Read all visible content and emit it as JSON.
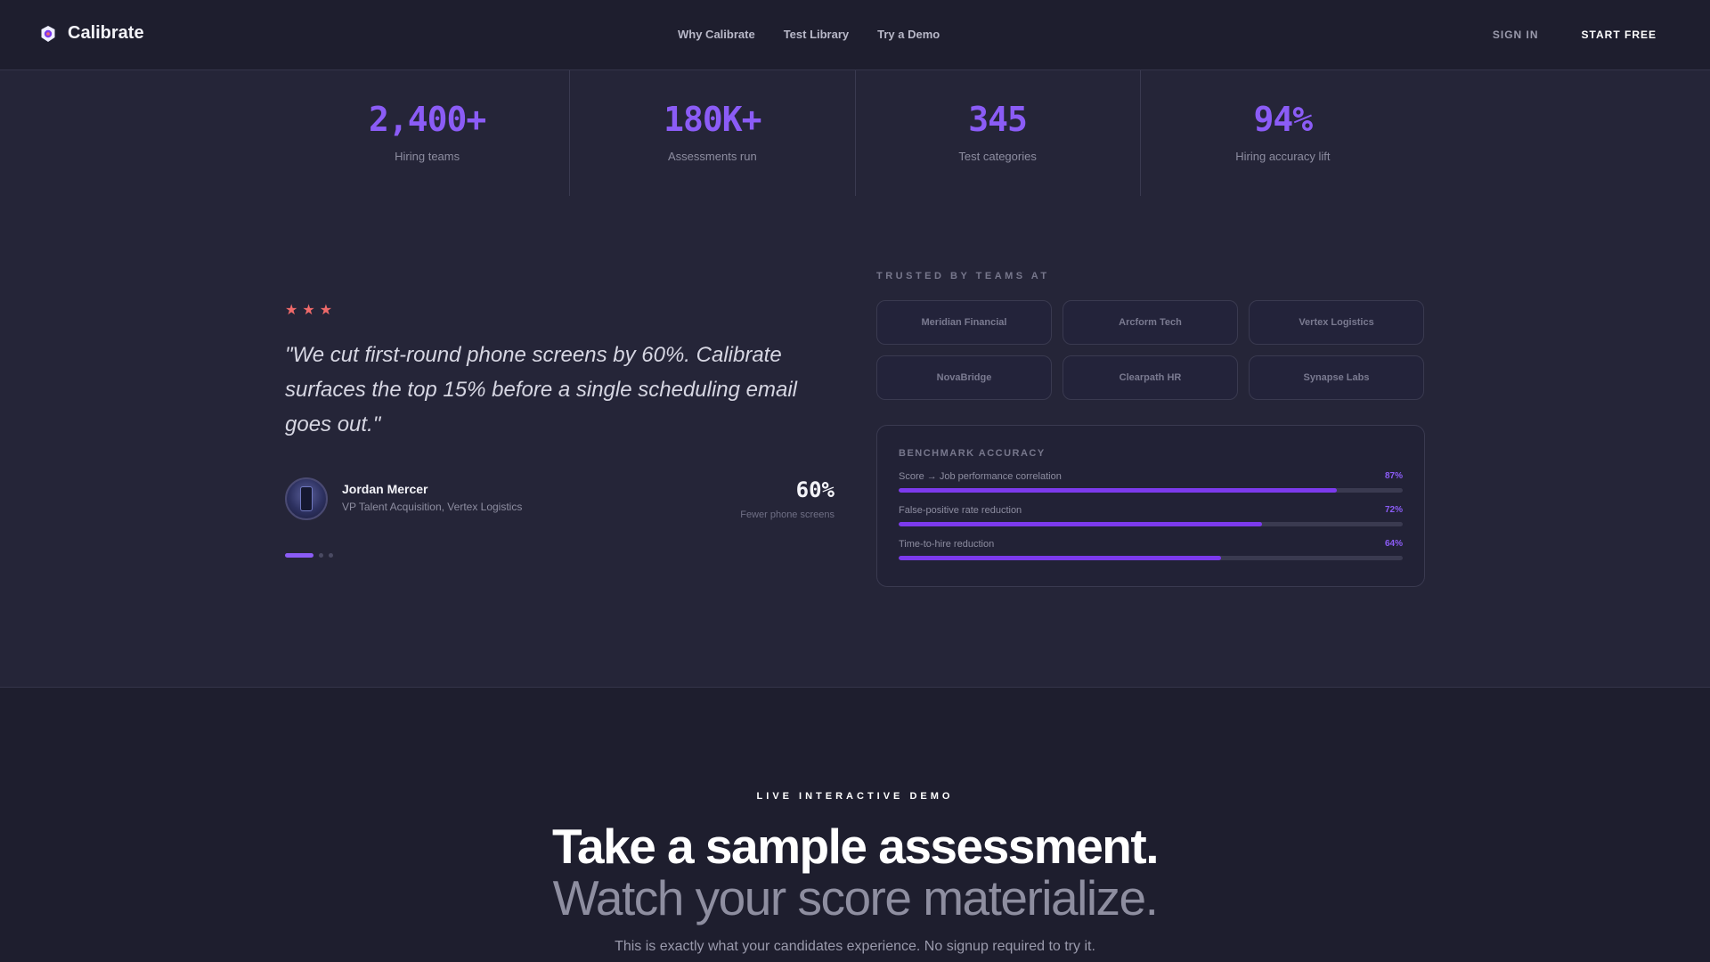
{
  "nav": {
    "brand": "Calibrate",
    "links": [
      "Why Calibrate",
      "Test Library",
      "Try a Demo"
    ],
    "sign_in": "SIGN IN",
    "start_free": "START FREE"
  },
  "stats": [
    {
      "value": "2,400+",
      "label": "Hiring teams"
    },
    {
      "value": "180K+",
      "label": "Assessments run"
    },
    {
      "value": "345",
      "label": "Test categories"
    },
    {
      "value": "94%",
      "label": "Hiring accuracy lift"
    }
  ],
  "testimonial": {
    "stars": 3,
    "quote": "\"We cut first-round phone screens by 60%. Calibrate surfaces the top 15% before a single scheduling email goes out.\"",
    "author_name": "Jordan Mercer",
    "author_title": "VP Talent Acquisition, Vertex Logistics",
    "metric_value": "60%",
    "metric_label": "Fewer phone screens",
    "slide_count": 3,
    "active_slide": 1
  },
  "trusted": {
    "label": "TRUSTED BY TEAMS AT",
    "logos": [
      "Meridian Financial",
      "Arcform Tech",
      "Vertex Logistics",
      "NovaBridge",
      "Clearpath HR",
      "Synapse Labs"
    ]
  },
  "benchmark": {
    "title": "BENCHMARK ACCURACY",
    "rows": [
      {
        "label": "Score → Job performance correlation",
        "value": 87,
        "display": "87%"
      },
      {
        "label": "False-positive rate reduction",
        "value": 72,
        "display": "72%"
      },
      {
        "label": "Time-to-hire reduction",
        "value": 64,
        "display": "64%"
      }
    ]
  },
  "demo": {
    "label": "LIVE INTERACTIVE DEMO",
    "title": "Take a sample assessment.",
    "subtitle": "Watch your score materialize.",
    "description": "This is exactly what your candidates experience. No signup required to try it."
  },
  "colors": {
    "accent": "#8b5cf6",
    "star": "#f06a6a",
    "background": "#252538",
    "nav_background": "#1e1e2e"
  }
}
